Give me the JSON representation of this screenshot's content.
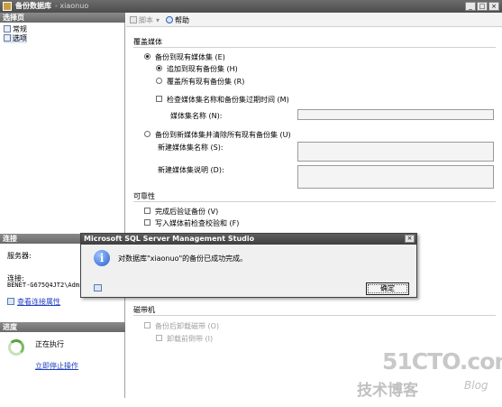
{
  "window": {
    "title": "备份数据库",
    "subtitle": "- xiaonuo"
  },
  "toolbar": {
    "script_label": "脚本",
    "help_label": "帮助"
  },
  "left": {
    "select_page_header": "选择页",
    "pages": [
      "常规",
      "选项"
    ],
    "connection_header": "连接",
    "server_label": "服务器:",
    "connection_label": "连接:",
    "connection_value": "BENET-G675Q4JT2\\Admini",
    "view_connection_link": "查看连接属性",
    "progress_header": "进度",
    "progress_status": "正在执行",
    "stop_link": "立即停止操作"
  },
  "overwrite": {
    "title": "覆盖媒体",
    "backup_existing": "备份到现有媒体集 (E)",
    "append": "追加到现有备份集 (H)",
    "overwrite_all": "覆盖所有现有备份集 (R)",
    "check_name": "检查媒体集名称和备份集过期时间 (M)",
    "media_set_name": "媒体集名称 (N):",
    "backup_new": "备份到新媒体集并清除所有现有备份集 (U)",
    "new_media_name": "新建媒体集名称 (S):",
    "new_media_desc": "新建媒体集说明 (D):"
  },
  "reliability": {
    "title": "可靠性",
    "verify": "完成后验证备份 (V)",
    "checksum": "写入媒体前检查校验和 (F)"
  },
  "tape": {
    "title": "磁带机",
    "unload": "备份后卸载磁带 (O)",
    "rewind": "卸载前倒带 (I)"
  },
  "dialog": {
    "title": "Microsoft SQL Server Management Studio",
    "message": "对数据库\"xiaonuo\"的备份已成功完成。",
    "ok_label": "确定"
  },
  "watermark": {
    "site": "51CTO.com",
    "blog_cn": "技术博客",
    "blog_en": "Blog"
  }
}
